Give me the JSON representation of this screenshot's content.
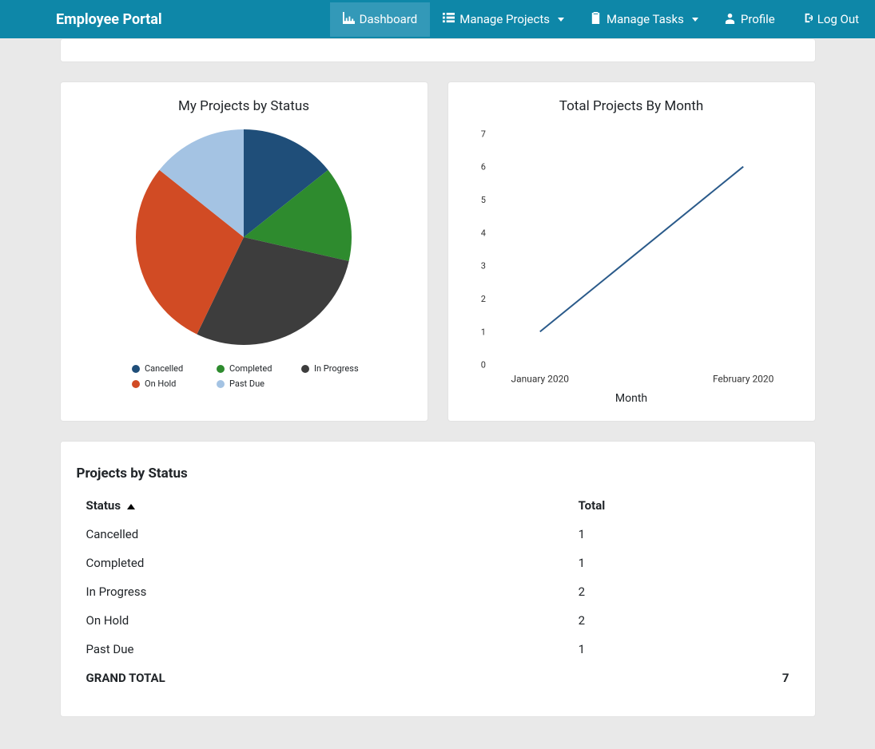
{
  "nav": {
    "brand": "Employee Portal",
    "items": [
      {
        "label": "Dashboard",
        "icon": "chart-line",
        "active": true,
        "dropdown": false
      },
      {
        "label": "Manage Projects",
        "icon": "list",
        "active": false,
        "dropdown": true
      },
      {
        "label": "Manage Tasks",
        "icon": "clipboard-check",
        "active": false,
        "dropdown": true
      },
      {
        "label": "Profile",
        "icon": "user",
        "active": false,
        "dropdown": false
      },
      {
        "label": "Log Out",
        "icon": "sign-out",
        "active": false,
        "dropdown": false
      }
    ]
  },
  "pie": {
    "title": "My Projects by Status"
  },
  "line": {
    "title": "Total Projects By Month",
    "xlabel": "Month"
  },
  "table": {
    "title": "Projects by Status",
    "columns": {
      "status": "Status",
      "total": "Total"
    },
    "rows": [
      {
        "status": "Cancelled",
        "total": 1
      },
      {
        "status": "Completed",
        "total": 1
      },
      {
        "status": "In Progress",
        "total": 2
      },
      {
        "status": "On Hold",
        "total": 2
      },
      {
        "status": "Past Due",
        "total": 1
      }
    ],
    "footer": {
      "label": "GRAND TOTAL",
      "total": 7
    }
  },
  "chart_data": [
    {
      "type": "pie",
      "title": "My Projects by Status",
      "series": [
        {
          "name": "Cancelled",
          "value": 1,
          "color": "#1f4e79"
        },
        {
          "name": "Completed",
          "value": 1,
          "color": "#2e8b2e"
        },
        {
          "name": "In Progress",
          "value": 2,
          "color": "#3d3d3d"
        },
        {
          "name": "On Hold",
          "value": 2,
          "color": "#d14b24"
        },
        {
          "name": "Past Due",
          "value": 1,
          "color": "#a4c3e3"
        }
      ]
    },
    {
      "type": "line",
      "title": "Total Projects By Month",
      "xlabel": "Month",
      "ylabel": "",
      "ylim": [
        0,
        7
      ],
      "categories": [
        "January 2020",
        "February 2020"
      ],
      "values": [
        1,
        6
      ]
    }
  ]
}
